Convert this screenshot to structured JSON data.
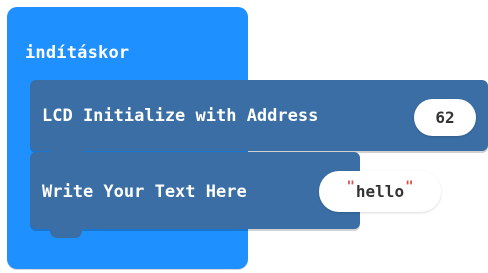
{
  "hat_block": {
    "label": "indításkor",
    "color": "#1e90ff"
  },
  "statements": [
    {
      "label": "LCD Initialize with Address",
      "value": "62",
      "color": "#3a6ea5"
    },
    {
      "label": "Write Your Text Here",
      "value": "hello",
      "quote_open": "\"",
      "quote_close": "\"",
      "quote_color": "#d9534f"
    }
  ]
}
